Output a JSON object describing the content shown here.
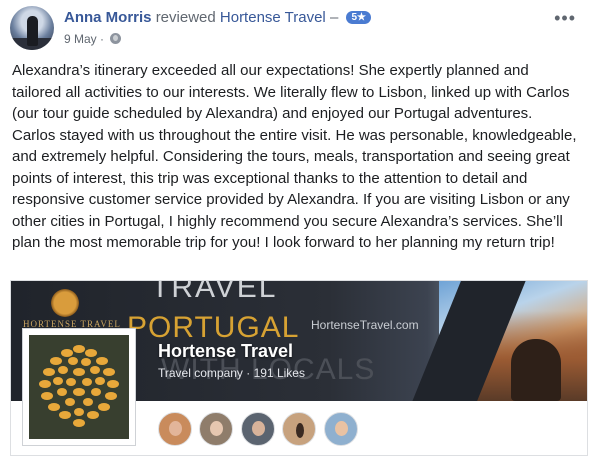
{
  "post": {
    "author": "Anna Morris",
    "verb": "reviewed",
    "page_name": "Hortense Travel",
    "separator": "–",
    "rating": "5★",
    "date": "9 May",
    "dot": "·",
    "more": "•••",
    "review_text": "Alexandra’s itinerary exceeded all our expectations! She expertly planned and tailored all activities to our interests. We literally flew to Lisbon, linked up with Carlos (our tour guide scheduled by Alexandra) and enjoyed our Portugal adventures. Carlos stayed with us throughout the entire visit. He was personable, knowledgeable, and extremely helpful. Considering the tours, meals, transportation and seeing great points of interest, this trip was exceptional thanks to the attention to detail and responsive customer service provided by Alexandra. If you are visiting Lisbon or any other cities in Portugal, I highly recommend you secure Alexandra’s services. She’ll plan the most memorable trip for you! I look forward to her planning my return trip!"
  },
  "page_card": {
    "cover": {
      "brand": "HORTENSE TRAVEL",
      "line1": "TRAVEL",
      "line2": "PORTUGAL",
      "url": "HortenseTravel.com",
      "line3": "WITH LOCALS"
    },
    "title": "Hortense Travel",
    "subtitle": "Travel company · 191 Likes",
    "likers": [
      {
        "name": "liker-1",
        "bg": "#c98b5c"
      },
      {
        "name": "liker-2",
        "bg": "#8f7d6b"
      },
      {
        "name": "liker-3",
        "bg": "#5b6470"
      },
      {
        "name": "liker-4",
        "bg": "#c7a27e"
      },
      {
        "name": "liker-5",
        "bg": "#8fb0cf"
      }
    ]
  },
  "colors": {
    "link": "#385898",
    "muted": "#606770",
    "badge": "#4a7bd1",
    "gold": "#d7a233"
  }
}
